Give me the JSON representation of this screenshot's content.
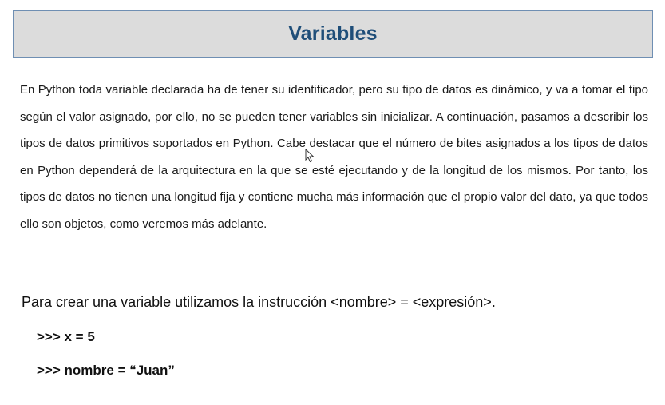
{
  "title": "Variables",
  "paragraph": "En Python toda variable declarada ha de tener su identificador, pero su tipo de datos es dinámico, y va a tomar el tipo según el valor asignado, por ello, no se pueden tener variables sin inicializar. A continuación, pasamos a describir los tipos de datos primitivos soportados en Python. Cabe destacar que el número de bites asignados a los tipos de datos en Python dependerá de la arquitectura en la que se esté ejecutando y de la longitud de los mismos. Por tanto, los tipos de datos no tienen una longitud fija y contiene mucha más información que el propio valor del dato, ya que todos ello son objetos, como veremos más adelante.",
  "intro": "Para crear una variable utilizamos la instrucción <nombre> = <expresión>.",
  "code_lines": [
    ">>> x = 5",
    ">>> nombre = “Juan”"
  ],
  "colors": {
    "title_text": "#1f4e79",
    "title_background": "#dcdcdc",
    "title_border": "#6f8fb3"
  },
  "icons": {
    "cursor": "mouse-pointer-icon"
  }
}
